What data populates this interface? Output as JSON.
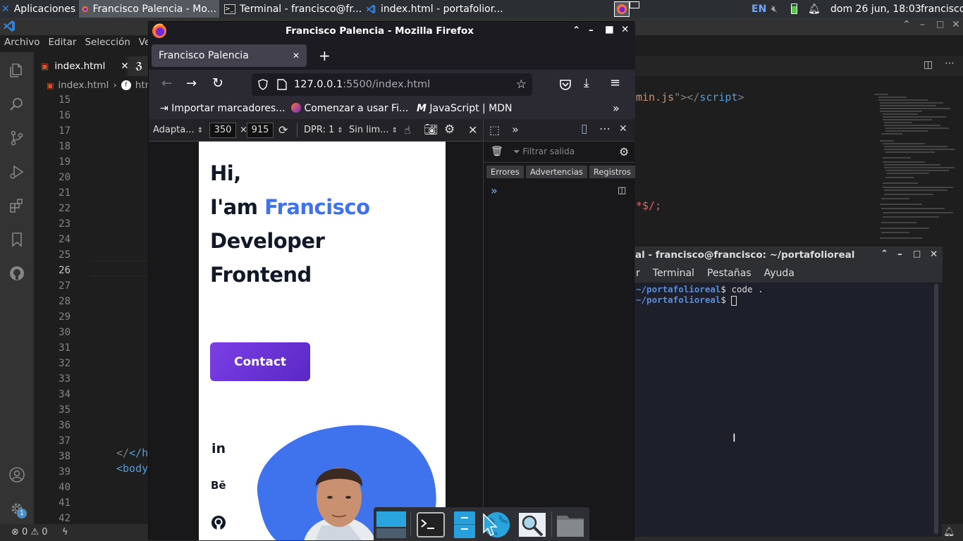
{
  "panel": {
    "apps_label": "Aplicaciones",
    "tasks": [
      {
        "label": "Francisco Palencia - Mo..."
      },
      {
        "label": "Terminal - francisco@fr..."
      },
      {
        "label": "index.html - portafolior..."
      }
    ],
    "keyboard": "EN",
    "datetime": "dom 26 jun, 18:03",
    "user": "francisco"
  },
  "vscode": {
    "menu": [
      "Archivo",
      "Editar",
      "Selección",
      "Ver"
    ],
    "menu_partial": "Ve",
    "tab_label": "index.html",
    "breadcrumbs": [
      "index.html",
      "htm"
    ],
    "line_numbers": [
      "15",
      "16",
      "17",
      "18",
      "19",
      "20",
      "21",
      "22",
      "23",
      "24",
      "25",
      "26",
      "27",
      "28",
      "29",
      "30",
      "31",
      "32",
      "33",
      "34",
      "35",
      "36",
      "37",
      "38",
      "39",
      "40",
      "41",
      "42"
    ],
    "active_line": "26",
    "code_snippet_1_a": "min.js",
    "code_snippet_1_b": "\"></",
    "code_snippet_1_c": "script",
    "code_snippet_1_d": ">",
    "code_snippet_2": "*$/;",
    "code_38": "</hea",
    "code_39": "<body",
    "status_errors": "0",
    "status_warnings": "0",
    "accounts_badge": "1"
  },
  "terminal": {
    "title": "al - francisco@francisco: ~/portafolioreal",
    "menu": [
      "r",
      "Terminal",
      "Pestañas",
      "Ayuda"
    ],
    "line1_path": "~/portafolioreal",
    "line1_cmd": "$ code .",
    "line2_path": "~/portafolioreal",
    "line2_cmd": "$ "
  },
  "firefox": {
    "window_title": "Francisco Palencia - Mozilla Firefox",
    "tab_title": "Francisco Palencia",
    "url_host": "127.0.0.1",
    "url_rest": ":5500/index.html",
    "bookmarks": [
      "Importar marcadores...",
      "Comenzar a usar Fi...",
      "JavaScript | MDN"
    ],
    "rdm": {
      "device": "Adapta...",
      "width": "350",
      "height": "915",
      "times": "×",
      "dpr": "DPR: 1",
      "throttle": "Sin lim..."
    },
    "devtools": {
      "filter_placeholder": "Filtrar salida",
      "filters": [
        "Errores",
        "Advertencias",
        "Registros"
      ]
    }
  },
  "webpage": {
    "line1": "Hi,",
    "line2_a": "I'am ",
    "line2_b": "Francisco",
    "line3": "Developer",
    "line4": "Frontend",
    "contact_button": "Contact",
    "social": [
      "in",
      "Bē"
    ],
    "accent_color": "#3f73ed",
    "button_color": "#6d34d8"
  }
}
